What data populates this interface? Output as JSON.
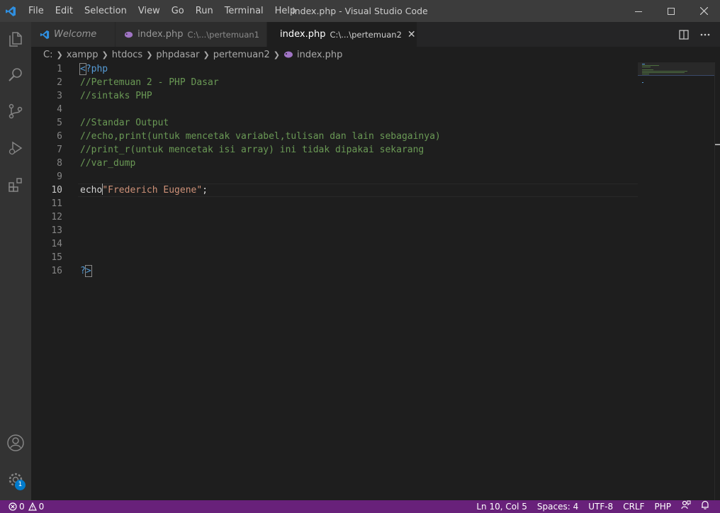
{
  "window": {
    "title": "index.php - Visual Studio Code",
    "menu": [
      "File",
      "Edit",
      "Selection",
      "View",
      "Go",
      "Run",
      "Terminal",
      "Help"
    ]
  },
  "activity_bar": {
    "items": [
      "files-icon",
      "search-icon",
      "source-control-icon",
      "run-debug-icon",
      "extensions-icon"
    ],
    "bottom": [
      "account-icon",
      "manage-gear-icon"
    ],
    "manage_badge": "1"
  },
  "tabs": [
    {
      "label": "Welcome",
      "path": "",
      "icon": "vscode-icon",
      "active": false
    },
    {
      "label": "index.php",
      "path": "C:\\...\\pertemuan1",
      "icon": "php-elephant-icon",
      "active": false
    },
    {
      "label": "index.php",
      "path": "C:\\...\\pertemuan2",
      "icon": "php-elephant-icon",
      "active": true
    }
  ],
  "breadcrumb": [
    "C:",
    "xampp",
    "htdocs",
    "phpdasar",
    "pertemuan2",
    "index.php"
  ],
  "editor": {
    "lines": [
      {
        "n": "1"
      },
      {
        "n": "2"
      },
      {
        "n": "3"
      },
      {
        "n": "4"
      },
      {
        "n": "5"
      },
      {
        "n": "6"
      },
      {
        "n": "7"
      },
      {
        "n": "8"
      },
      {
        "n": "9"
      },
      {
        "n": "10"
      },
      {
        "n": "11"
      },
      {
        "n": "12"
      },
      {
        "n": "13"
      },
      {
        "n": "14"
      },
      {
        "n": "15"
      },
      {
        "n": "16"
      }
    ],
    "code": {
      "l1_open": "<",
      "l1_rest": "?php",
      "l2": "//Pertemuan 2 - PHP Dasar",
      "l3": "//sintaks PHP",
      "l5": "//Standar Output",
      "l6": "//echo,print(untuk mencetak variabel,tulisan dan lain sebagainya)",
      "l7": "//print_r(untuk mencetak isi array) ini tidak dipakai sekarang",
      "l8": "//var_dump",
      "l10_kw": "echo",
      "l10_str": "\"Frederich Eugene\"",
      "l10_end": ";",
      "l16_q": "?",
      "l16_close": ">"
    },
    "current_line": "10"
  },
  "status_bar": {
    "errors": "0",
    "warnings": "0",
    "position": "Ln 10, Col 5",
    "spaces": "Spaces: 4",
    "encoding": "UTF-8",
    "eol": "CRLF",
    "language": "PHP"
  },
  "colors": {
    "statusbar": "#68217a",
    "comment": "#6a9955",
    "tag": "#569cd6",
    "string": "#ce9178",
    "badge": "#007acc"
  }
}
